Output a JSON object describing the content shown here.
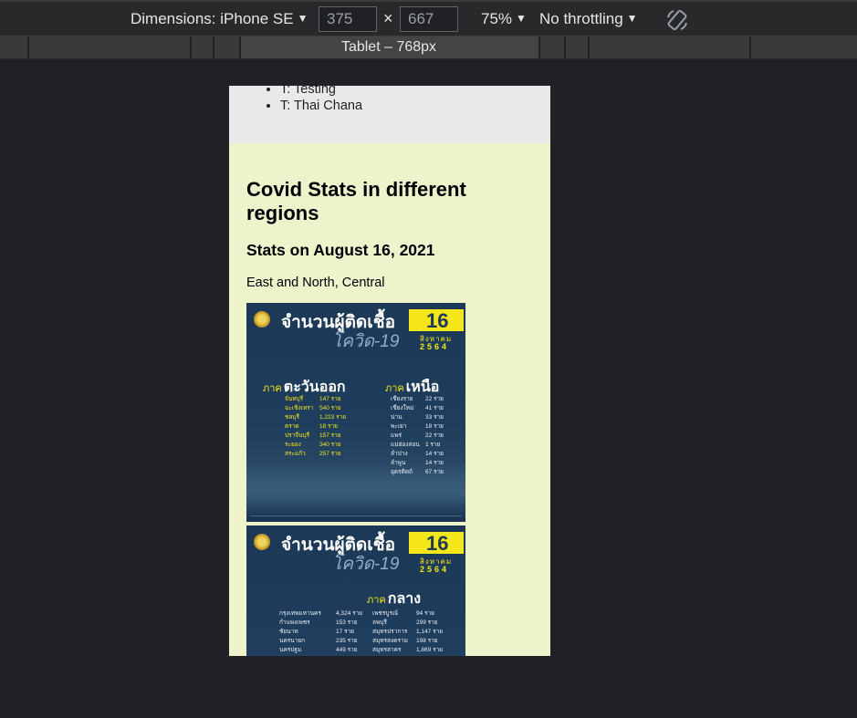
{
  "toolbar": {
    "dimensions_label": "Dimensions: iPhone SE",
    "width_value": "375",
    "height_value": "667",
    "times": "×",
    "zoom": "75%",
    "throttling": "No throttling",
    "caret": "▼"
  },
  "media_query_bar": {
    "label": "Tablet – 768px"
  },
  "page": {
    "nav_items": [
      "T: Testing",
      "T: Thai Chana"
    ],
    "heading": "Covid Stats in different regions",
    "subheading": "Stats on August 16, 2021",
    "regions_text": "East and North, Central"
  },
  "infographics": [
    {
      "title": "จำนวนผู้ติดเชื้อ",
      "subtitle": "โควิด-19",
      "day": "16",
      "month": "สิงหาคม",
      "year": "2564",
      "region_prefix": "ภาค",
      "regions": [
        {
          "name": "ตะวันออก",
          "rows": [
            [
              "จันทบุรี",
              "147 ราย"
            ],
            [
              "ฉะเชิงเทรา",
              "540 ราย"
            ],
            [
              "ชลบุรี",
              "1,223 ราย"
            ],
            [
              "ตราด",
              "18 ราย"
            ],
            [
              "ปราจีนบุรี",
              "157 ราย"
            ],
            [
              "ระยอง",
              "340 ราย"
            ],
            [
              "สระแก้ว",
              "257 ราย"
            ]
          ]
        },
        {
          "name": "เหนือ",
          "rows": [
            [
              "เชียงราย",
              "22 ราย"
            ],
            [
              "เชียงใหม่",
              "41 ราย"
            ],
            [
              "น่าน",
              "33 ราย"
            ],
            [
              "พะเยา",
              "18 ราย"
            ],
            [
              "แพร่",
              "22 ราย"
            ],
            [
              "แม่ฮ่องสอน",
              "1 ราย"
            ],
            [
              "ลำปาง",
              "14 ราย"
            ],
            [
              "ลำพูน",
              "14 ราย"
            ],
            [
              "อุตรดิตถ์",
              "67 ราย"
            ]
          ]
        }
      ]
    },
    {
      "title": "จำนวนผู้ติดเชื้อ",
      "subtitle": "โควิด-19",
      "day": "16",
      "month": "สิงหาคม",
      "year": "2564",
      "region_prefix": "ภาค",
      "regions": [
        {
          "name": "กลาง",
          "rows_left": [
            [
              "กรุงเทพมหานคร",
              "4,324 ราย"
            ],
            [
              "กำแพงเพชร",
              "153 ราย"
            ],
            [
              "ชัยนาท",
              "17 ราย"
            ],
            [
              "นครนายก",
              "235 ราย"
            ],
            [
              "นครปฐม",
              "449 ราย"
            ]
          ],
          "rows_right": [
            [
              "เพชรบูรณ์",
              "94 ราย"
            ],
            [
              "ลพบุรี",
              "299 ราย"
            ],
            [
              "สมุทรปราการ",
              "1,147 ราย"
            ],
            [
              "สมุทรสงคราม",
              "198 ราย"
            ],
            [
              "สมุทรสาคร",
              "1,869 ราย"
            ]
          ]
        }
      ]
    }
  ]
}
